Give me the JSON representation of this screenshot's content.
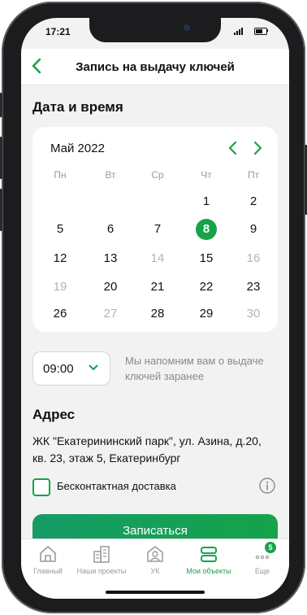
{
  "status_bar": {
    "time": "17:21"
  },
  "header": {
    "title": "Запись на выдачу ключей",
    "back_icon": "chevron-left-icon"
  },
  "section_datetime": {
    "title": "Дата и время"
  },
  "calendar": {
    "month_label": "Май 2022",
    "weekdays": [
      "Пн",
      "Вт",
      "Ср",
      "Чт",
      "Пт"
    ],
    "selected_day": "8",
    "rows": [
      [
        null,
        null,
        null,
        {
          "d": "1",
          "muted": false
        },
        {
          "d": "2",
          "muted": false
        }
      ],
      [
        {
          "d": "5",
          "muted": false
        },
        {
          "d": "6",
          "muted": false
        },
        {
          "d": "7",
          "muted": false
        },
        {
          "d": "8",
          "muted": false
        },
        {
          "d": "9",
          "muted": false
        }
      ],
      [
        {
          "d": "12",
          "muted": false
        },
        {
          "d": "13",
          "muted": false
        },
        {
          "d": "14",
          "muted": true
        },
        {
          "d": "15",
          "muted": false
        },
        {
          "d": "16",
          "muted": true
        }
      ],
      [
        {
          "d": "19",
          "muted": true
        },
        {
          "d": "20",
          "muted": false
        },
        {
          "d": "21",
          "muted": false
        },
        {
          "d": "22",
          "muted": false
        },
        {
          "d": "23",
          "muted": false
        }
      ],
      [
        {
          "d": "26",
          "muted": false
        },
        {
          "d": "27",
          "muted": true
        },
        {
          "d": "28",
          "muted": false
        },
        {
          "d": "29",
          "muted": false
        },
        {
          "d": "30",
          "muted": true
        }
      ]
    ]
  },
  "time_picker": {
    "value": "09:00"
  },
  "reminder_text": "Мы напомним вам о выдаче ключей заранее",
  "section_address": {
    "title": "Адрес",
    "text": "ЖК \"Екатерининский парк\", ул. Азина, д.20, кв. 23, этаж 5, Екатеринбург"
  },
  "contactless": {
    "label": "Бесконтактная доставка",
    "checked": false
  },
  "submit_button": {
    "label": "Записаться"
  },
  "tabbar": {
    "items": [
      {
        "label": "Главный",
        "icon": "home-icon"
      },
      {
        "label": "Наши проекты",
        "icon": "buildings-icon"
      },
      {
        "label": "УК",
        "icon": "management-company-icon"
      },
      {
        "label": "Мои объекты",
        "icon": "my-objects-icon"
      },
      {
        "label": "Еще",
        "icon": "more-icon"
      }
    ],
    "active": "Мои объекты",
    "more_badge": "5"
  },
  "colors": {
    "accent": "#16a34a",
    "background": "#f2f2f2",
    "muted_text": "#9a9a9a"
  }
}
